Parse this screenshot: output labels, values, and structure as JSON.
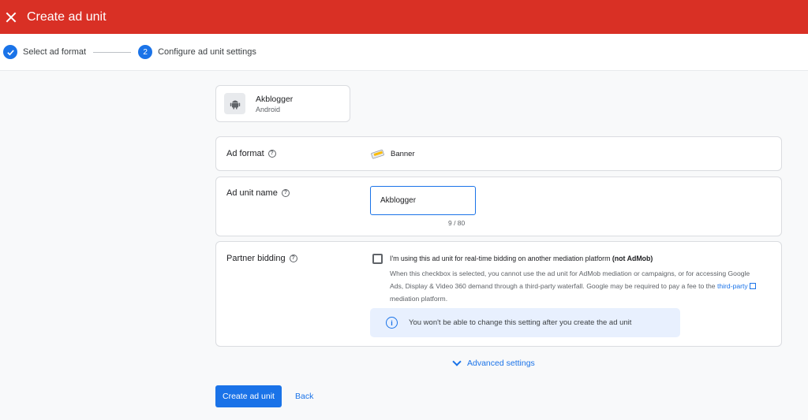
{
  "header": {
    "title": "Create ad unit",
    "close_icon": "close-icon",
    "color": "#d93025"
  },
  "stepper": {
    "steps": [
      {
        "label": "Select ad format",
        "state": "completed",
        "icon": "check-icon"
      },
      {
        "label": "Configure ad unit settings",
        "state": "active",
        "number": "2"
      }
    ]
  },
  "app": {
    "name": "Akblogger",
    "platform": "Android",
    "icon": "android-icon"
  },
  "ad_format": {
    "label": "Ad format",
    "value": "Banner",
    "icon": "banner-icon"
  },
  "ad_unit_name": {
    "label": "Ad unit name",
    "value": "Akblogger",
    "counter": "9 / 80"
  },
  "partner_bidding": {
    "label": "Partner bidding",
    "checkbox_label": "I'm using this ad unit for real-time bidding on another mediation platform",
    "checkbox_label_bold": "(not AdMob)",
    "checked": false,
    "description_prefix": "When this checkbox is selected, you cannot use the ad unit for AdMob mediation or campaigns, or for accessing Google Ads, Display & Video 360 demand through a third-party waterfall. Google may be required to pay a fee to the",
    "description_link": "third-party",
    "description_suffix": "mediation platform.",
    "info_text": "You won't be able to change this setting after you create the ad unit"
  },
  "advanced_settings": {
    "label": "Advanced settings"
  },
  "actions": {
    "primary": "Create ad unit",
    "secondary": "Back"
  },
  "colors": {
    "accent": "#1a73e8",
    "brand": "#d93025",
    "info_bg": "#e8f0fe"
  }
}
